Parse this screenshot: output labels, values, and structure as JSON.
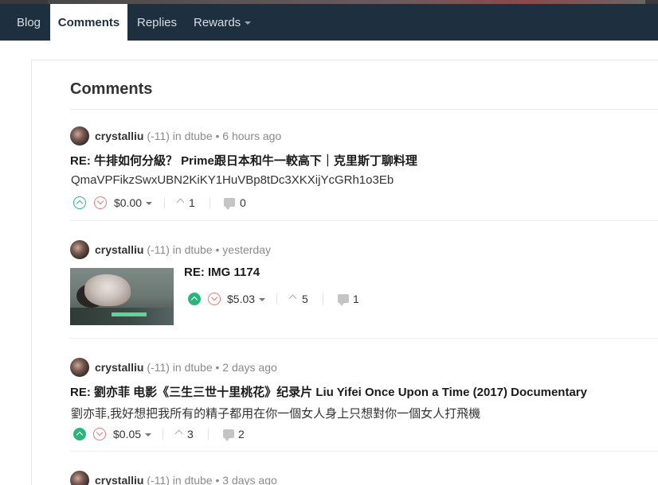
{
  "nav": {
    "items": [
      {
        "label": "Blog"
      },
      {
        "label": "Comments"
      },
      {
        "label": "Replies"
      },
      {
        "label": "Rewards"
      }
    ]
  },
  "page": {
    "heading": "Comments"
  },
  "comments": [
    {
      "author": "crystalliu",
      "reputation": "(-11)",
      "meta": "in dtube • 6 hours ago",
      "title": "RE: 牛排如何分級？ Prime跟日本和牛一較高下｜克里斯丁聊料理",
      "body": "QmaVPFikzSwxUBN2KiKY1HuVBp8tDc3XKXijYcGRh1o3Eb",
      "payout": "$0.00",
      "votes": "1",
      "replies": "0"
    },
    {
      "author": "crystalliu",
      "reputation": "(-11)",
      "meta": "in dtube • yesterday",
      "title": "RE: IMG 1174",
      "payout": "$5.03",
      "votes": "5",
      "replies": "1"
    },
    {
      "author": "crystalliu",
      "reputation": "(-11)",
      "meta": "in dtube • 2 days ago",
      "title": "RE: 劉亦菲 电影《三生三世十里桃花》纪录片 Liu Yifei Once Upon a Time (2017) Documentary",
      "body": "劉亦菲,我好想把我所有的精子都用在你一個女人身上只想對你一個女人打飛機",
      "payout": "$0.05",
      "votes": "3",
      "replies": "2"
    },
    {
      "author": "crystalliu",
      "reputation": "(-11)",
      "meta": "in dtube • 3 days ago"
    }
  ]
}
